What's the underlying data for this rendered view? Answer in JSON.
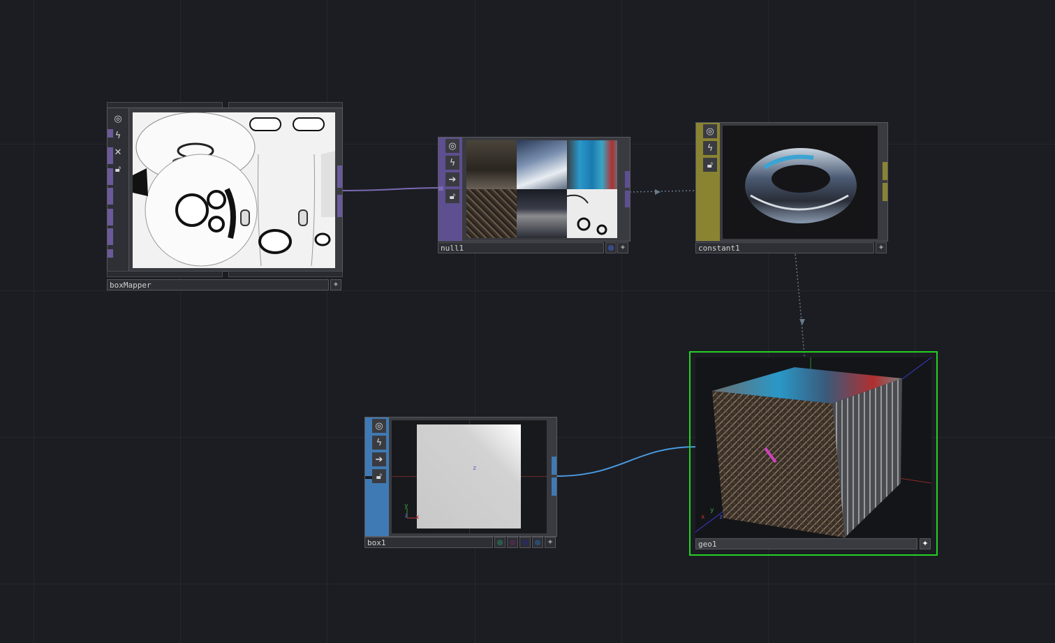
{
  "app": {
    "name": "TouchDesigner network editor"
  },
  "nodes": {
    "boxMapper": {
      "name": "boxMapper",
      "color": "#6a5a9a",
      "icons": [
        "viewer-active-icon",
        "cook-icon",
        "bypass-icon",
        "lock-icon"
      ]
    },
    "null1": {
      "name": "null1",
      "color": "#6a5a9a",
      "icons": [
        "viewer-active-icon",
        "cook-icon",
        "export-icon",
        "lock-icon"
      ]
    },
    "constant1": {
      "name": "constant1",
      "color": "#9a9438",
      "icons": [
        "viewer-active-icon",
        "cook-icon",
        "lock-icon"
      ]
    },
    "box1": {
      "name": "box1",
      "color": "#3f7ab4",
      "icons": [
        "viewer-active-icon",
        "cook-icon",
        "export-icon",
        "lock-icon"
      ],
      "viewport_axis": "z",
      "axis_labels": {
        "x": "x",
        "y": "y",
        "z": "z"
      }
    },
    "geo1": {
      "name": "geo1",
      "selected_color": "#22d222",
      "axis_labels": {
        "x": "x",
        "y": "y",
        "z": "z"
      }
    }
  },
  "connections": [
    {
      "from": "boxMapper",
      "to": "null1",
      "type": "TOP",
      "color": "#7a6ab4"
    },
    {
      "from": "null1",
      "to": "constant1",
      "type": "reference",
      "style": "dotted"
    },
    {
      "from": "constant1",
      "to": "geo1",
      "type": "reference",
      "style": "dotted"
    },
    {
      "from": "box1",
      "to": "geo1",
      "type": "SOP",
      "color": "#4a9ae0"
    }
  ]
}
